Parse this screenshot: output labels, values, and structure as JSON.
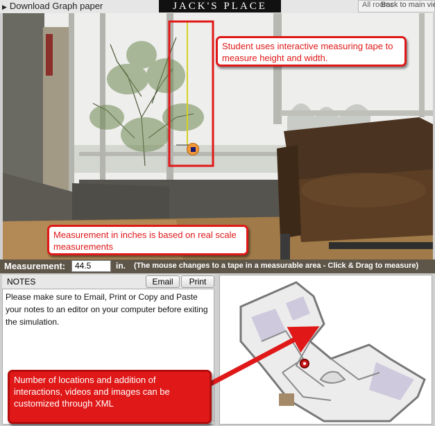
{
  "topbar": {
    "download_label": "Download Graph paper",
    "brand": "JACK'S PLACE",
    "back_label": "Back to main view",
    "all_rooms_label": "All rooms"
  },
  "measurement": {
    "label": "Measurement:",
    "value": "44.5",
    "unit": "in.",
    "hint": "(The mouse changes to a tape in a measurable area - Click & Drag to measure)"
  },
  "notes": {
    "title": "NOTES",
    "email_label": "Email",
    "print_label": "Print",
    "text": "Please make sure to Email, Print or Copy and Paste your notes to an editor on your computer before exiting the simulation."
  },
  "annotations": {
    "tape": "Student uses interactive measuring tape to measure height and width.",
    "inches": "Measurement in inches is based on real scale measurements",
    "xml": "Number of locations and addition of interactions, videos and images can be customized through XML"
  },
  "colors": {
    "callout_red": "#e01818",
    "strip_bg": "#5e5649",
    "brand_bg": "#111111"
  },
  "icons": {
    "download": "triangle-right",
    "tape_handle": "orange-circle-square",
    "map_marker": "red-location-pin"
  }
}
